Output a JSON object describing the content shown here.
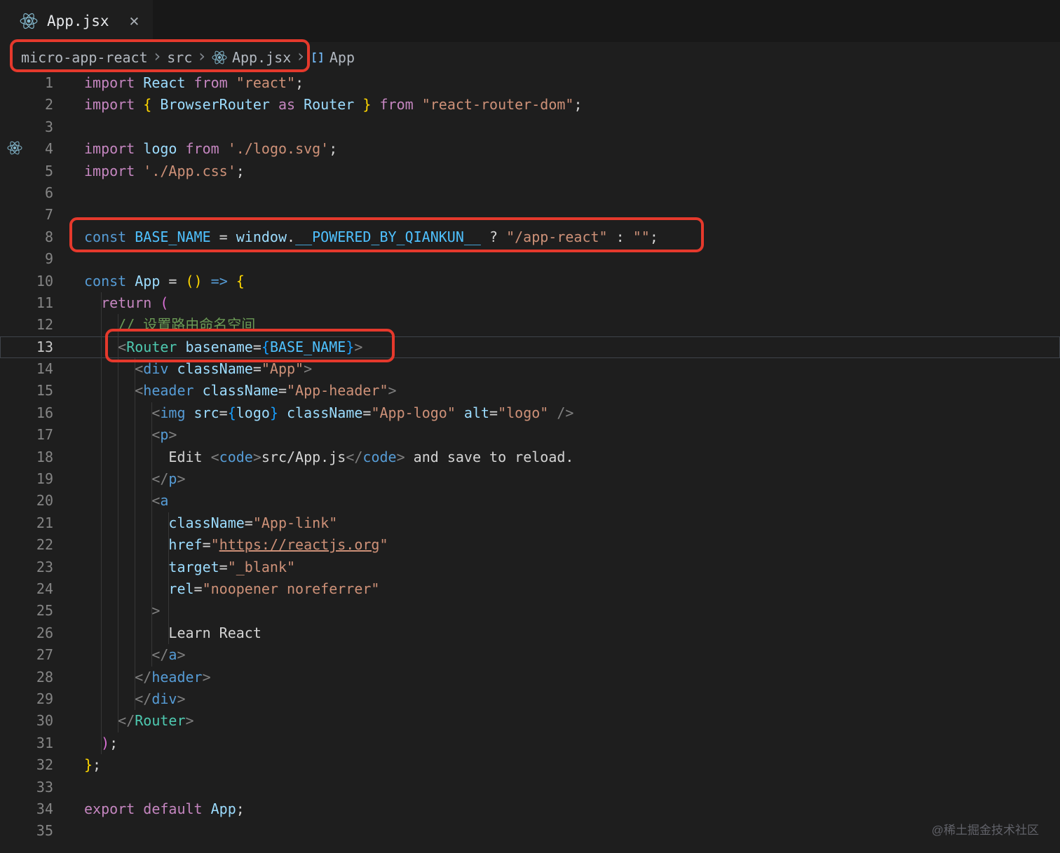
{
  "tab": {
    "title": "App.jsx",
    "close": "✕"
  },
  "breadcrumb": {
    "items": [
      "micro-app-react",
      "src",
      "App.jsx",
      "App"
    ],
    "separator": "›"
  },
  "colors": {
    "annotation": "#e5392c",
    "react_icon": "#83b7cc",
    "symbol_icon": "#75beff"
  },
  "watermark": "@稀土掘金技术社区",
  "editor": {
    "active_line": 13,
    "palette": {
      "kw": "#c586c0",
      "kwb": "#569cd6",
      "id": "#9cdcfe",
      "cn": "#4fc1ff",
      "str": "#ce9178",
      "pun": "#d4d4d4",
      "br1": "#ffd700",
      "br2": "#da70d6",
      "br3": "#179fff",
      "tag": "#569cd6",
      "cmp": "#4ec9b0",
      "com": "#6a9955",
      "txt": "#d4d4d4",
      "ang": "#808080"
    },
    "lines": [
      {
        "n": 1,
        "s": [
          [
            "import ",
            "kw"
          ],
          [
            "React ",
            "id"
          ],
          [
            "from ",
            "kw"
          ],
          [
            "\"react\"",
            "str"
          ],
          [
            ";",
            "pun"
          ]
        ]
      },
      {
        "n": 2,
        "s": [
          [
            "import ",
            "kw"
          ],
          [
            "{ ",
            "br1"
          ],
          [
            "BrowserRouter ",
            "id"
          ],
          [
            "as ",
            "kw"
          ],
          [
            "Router ",
            "id"
          ],
          [
            "} ",
            "br1"
          ],
          [
            "from ",
            "kw"
          ],
          [
            "\"react-router-dom\"",
            "str"
          ],
          [
            ";",
            "pun"
          ]
        ]
      },
      {
        "n": 3,
        "s": []
      },
      {
        "n": 4,
        "s": [
          [
            "import ",
            "kw"
          ],
          [
            "logo ",
            "id"
          ],
          [
            "from ",
            "kw"
          ],
          [
            "'./logo.svg'",
            "str"
          ],
          [
            ";",
            "pun"
          ]
        ]
      },
      {
        "n": 5,
        "s": [
          [
            "import ",
            "kw"
          ],
          [
            "'./App.css'",
            "str"
          ],
          [
            ";",
            "pun"
          ]
        ]
      },
      {
        "n": 6,
        "s": []
      },
      {
        "n": 7,
        "s": []
      },
      {
        "n": 8,
        "s": [
          [
            "const ",
            "kwb"
          ],
          [
            "BASE_NAME ",
            "cn"
          ],
          [
            "= ",
            "pun"
          ],
          [
            "window",
            "id"
          ],
          [
            ".",
            "pun"
          ],
          [
            "__POWERED_BY_QIANKUN__",
            "cn"
          ],
          [
            " ? ",
            "pun"
          ],
          [
            "\"/app-react\"",
            "str"
          ],
          [
            " : ",
            "pun"
          ],
          [
            "\"\"",
            "str"
          ],
          [
            ";",
            "pun"
          ]
        ]
      },
      {
        "n": 9,
        "s": []
      },
      {
        "n": 10,
        "s": [
          [
            "const ",
            "kwb"
          ],
          [
            "App ",
            "id"
          ],
          [
            "= ",
            "pun"
          ],
          [
            "()",
            "br1"
          ],
          [
            " ",
            "pun"
          ],
          [
            "=>",
            "kwb"
          ],
          [
            " ",
            "pun"
          ],
          [
            "{",
            "br1"
          ]
        ]
      },
      {
        "n": 11,
        "s": [
          [
            "  ",
            "pun"
          ],
          [
            "return ",
            "kw"
          ],
          [
            "(",
            "br2"
          ]
        ]
      },
      {
        "n": 12,
        "s": [
          [
            "    // 设置路由命名空间",
            "com"
          ]
        ]
      },
      {
        "n": 13,
        "s": [
          [
            "    ",
            "pun"
          ],
          [
            "<",
            "ang"
          ],
          [
            "Router ",
            "cmp"
          ],
          [
            "basename",
            "id"
          ],
          [
            "=",
            "pun"
          ],
          [
            "{",
            "br3"
          ],
          [
            "BASE_NAME",
            "cn"
          ],
          [
            "}",
            "br3"
          ],
          [
            ">",
            "ang"
          ]
        ]
      },
      {
        "n": 14,
        "s": [
          [
            "      ",
            "pun"
          ],
          [
            "<",
            "ang"
          ],
          [
            "div ",
            "tag"
          ],
          [
            "className",
            "id"
          ],
          [
            "=",
            "pun"
          ],
          [
            "\"App\"",
            "str"
          ],
          [
            ">",
            "ang"
          ]
        ]
      },
      {
        "n": 15,
        "s": [
          [
            "      ",
            "pun"
          ],
          [
            "<",
            "ang"
          ],
          [
            "header ",
            "tag"
          ],
          [
            "className",
            "id"
          ],
          [
            "=",
            "pun"
          ],
          [
            "\"App-header\"",
            "str"
          ],
          [
            ">",
            "ang"
          ]
        ]
      },
      {
        "n": 16,
        "s": [
          [
            "        ",
            "pun"
          ],
          [
            "<",
            "ang"
          ],
          [
            "img ",
            "tag"
          ],
          [
            "src",
            "id"
          ],
          [
            "=",
            "pun"
          ],
          [
            "{",
            "br3"
          ],
          [
            "logo",
            "id"
          ],
          [
            "}",
            "br3"
          ],
          [
            " ",
            "pun"
          ],
          [
            "className",
            "id"
          ],
          [
            "=",
            "pun"
          ],
          [
            "\"App-logo\" ",
            "str"
          ],
          [
            "alt",
            "id"
          ],
          [
            "=",
            "pun"
          ],
          [
            "\"logo\" ",
            "str"
          ],
          [
            "/>",
            "ang"
          ]
        ]
      },
      {
        "n": 17,
        "s": [
          [
            "        ",
            "pun"
          ],
          [
            "<",
            "ang"
          ],
          [
            "p",
            "tag"
          ],
          [
            ">",
            "ang"
          ]
        ]
      },
      {
        "n": 18,
        "s": [
          [
            "          Edit ",
            "txt"
          ],
          [
            "<",
            "ang"
          ],
          [
            "code",
            "tag"
          ],
          [
            ">",
            "ang"
          ],
          [
            "src/App.js",
            "txt"
          ],
          [
            "</",
            "ang"
          ],
          [
            "code",
            "tag"
          ],
          [
            ">",
            "ang"
          ],
          [
            " and save to reload.",
            "txt"
          ]
        ]
      },
      {
        "n": 19,
        "s": [
          [
            "        ",
            "pun"
          ],
          [
            "</",
            "ang"
          ],
          [
            "p",
            "tag"
          ],
          [
            ">",
            "ang"
          ]
        ]
      },
      {
        "n": 20,
        "s": [
          [
            "        ",
            "pun"
          ],
          [
            "<",
            "ang"
          ],
          [
            "a",
            "tag"
          ]
        ]
      },
      {
        "n": 21,
        "s": [
          [
            "          ",
            "pun"
          ],
          [
            "className",
            "id"
          ],
          [
            "=",
            "pun"
          ],
          [
            "\"App-link\"",
            "str"
          ]
        ]
      },
      {
        "n": 22,
        "s": [
          [
            "          ",
            "pun"
          ],
          [
            "href",
            "id"
          ],
          [
            "=",
            "pun"
          ],
          [
            "\"",
            "str"
          ],
          [
            "https://reactjs.org",
            "str",
            true
          ],
          [
            "\"",
            "str"
          ]
        ]
      },
      {
        "n": 23,
        "s": [
          [
            "          ",
            "pun"
          ],
          [
            "target",
            "id"
          ],
          [
            "=",
            "pun"
          ],
          [
            "\"_blank\"",
            "str"
          ]
        ]
      },
      {
        "n": 24,
        "s": [
          [
            "          ",
            "pun"
          ],
          [
            "rel",
            "id"
          ],
          [
            "=",
            "pun"
          ],
          [
            "\"noopener noreferrer\"",
            "str"
          ]
        ]
      },
      {
        "n": 25,
        "s": [
          [
            "        ",
            "pun"
          ],
          [
            ">",
            "ang"
          ]
        ]
      },
      {
        "n": 26,
        "s": [
          [
            "          Learn React",
            "txt"
          ]
        ]
      },
      {
        "n": 27,
        "s": [
          [
            "        ",
            "pun"
          ],
          [
            "</",
            "ang"
          ],
          [
            "a",
            "tag"
          ],
          [
            ">",
            "ang"
          ]
        ]
      },
      {
        "n": 28,
        "s": [
          [
            "      ",
            "pun"
          ],
          [
            "</",
            "ang"
          ],
          [
            "header",
            "tag"
          ],
          [
            ">",
            "ang"
          ]
        ]
      },
      {
        "n": 29,
        "s": [
          [
            "      ",
            "pun"
          ],
          [
            "</",
            "ang"
          ],
          [
            "div",
            "tag"
          ],
          [
            ">",
            "ang"
          ]
        ]
      },
      {
        "n": 30,
        "s": [
          [
            "    ",
            "pun"
          ],
          [
            "</",
            "ang"
          ],
          [
            "Router",
            "cmp"
          ],
          [
            ">",
            "ang"
          ]
        ]
      },
      {
        "n": 31,
        "s": [
          [
            "  ",
            "pun"
          ],
          [
            ")",
            "br2"
          ],
          [
            ";",
            "pun"
          ]
        ]
      },
      {
        "n": 32,
        "s": [
          [
            "}",
            "br1"
          ],
          [
            ";",
            "pun"
          ]
        ]
      },
      {
        "n": 33,
        "s": []
      },
      {
        "n": 34,
        "s": [
          [
            "export ",
            "kw"
          ],
          [
            "default ",
            "kw"
          ],
          [
            "App",
            "id"
          ],
          [
            ";",
            "pun"
          ]
        ]
      },
      {
        "n": 35,
        "s": []
      }
    ]
  }
}
